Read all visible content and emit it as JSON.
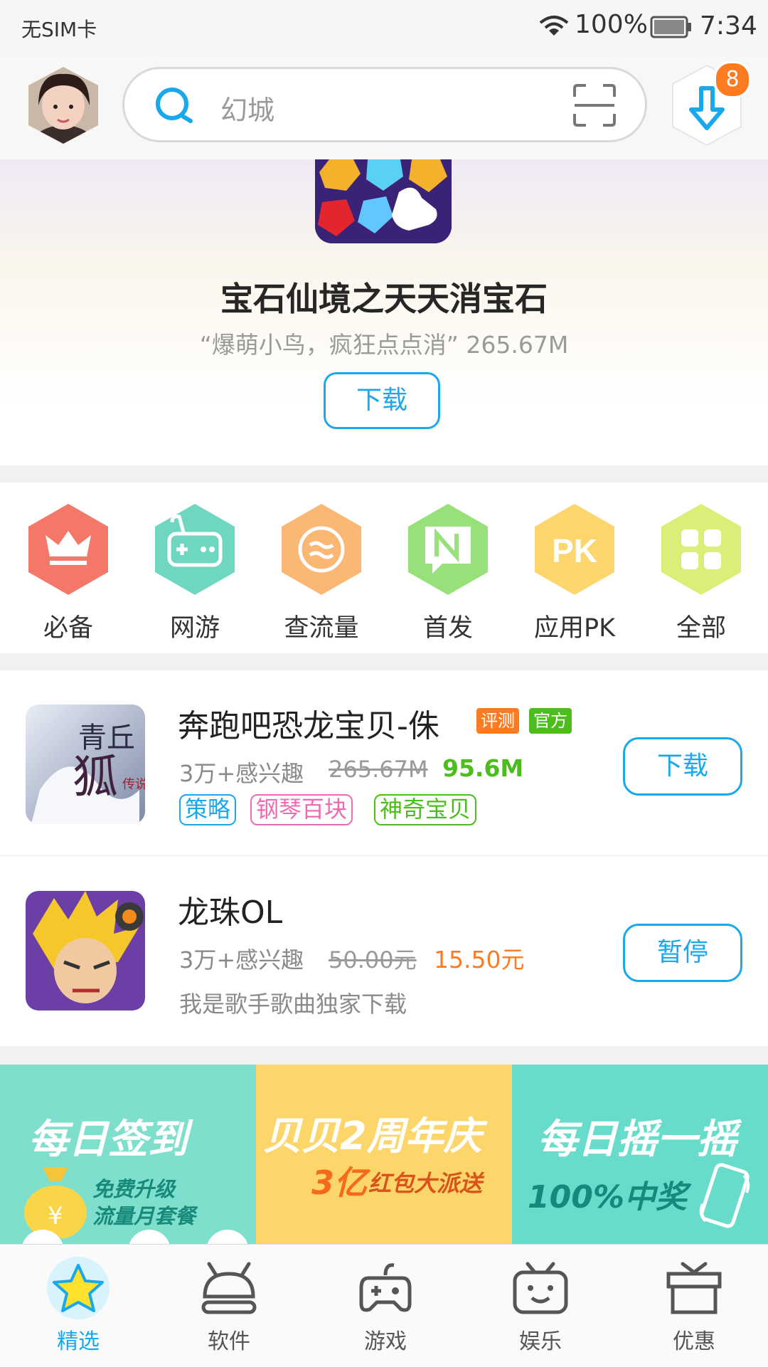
{
  "status_bar": {
    "carrier": "无SIM卡",
    "battery": "100%",
    "time": "7:34"
  },
  "search": {
    "placeholder": "幻城"
  },
  "download_badge": "8",
  "featured": {
    "title": "宝石仙境之天天消宝石",
    "subtitle": "“爆萌小鸟，疯狂点点消” 265.67M",
    "button": "下载"
  },
  "categories": [
    {
      "label": "必备",
      "icon": "crown-icon",
      "color": "#f4786a"
    },
    {
      "label": "网游",
      "icon": "gamepad-icon",
      "color": "#6fd6c1"
    },
    {
      "label": "查流量",
      "icon": "traffic-icon",
      "color": "#fbb774"
    },
    {
      "label": "首发",
      "icon": "new-flag-icon",
      "color": "#97e07a"
    },
    {
      "label": "应用PK",
      "icon": "pk-icon",
      "color": "#fdd66d"
    },
    {
      "label": "全部",
      "icon": "grid-icon",
      "color": "#d9ef78"
    }
  ],
  "apps": [
    {
      "title": "奔跑吧恐龙宝贝-侏",
      "badge_review": "评测",
      "badge_official": "官方",
      "interest": "3万+感兴趣",
      "old_size": "265.67M",
      "new_size": "95.6M",
      "tags": [
        "策略",
        "钢琴百块",
        "神奇宝贝"
      ],
      "button": "下载",
      "icon_text": [
        "青丘",
        "狐",
        "传说"
      ]
    },
    {
      "title": "龙珠OL",
      "interest": "3万+感兴趣",
      "old_price": "50.00元",
      "new_price": "15.50元",
      "desc": "我是歌手歌曲独家下载",
      "button": "暂停"
    }
  ],
  "promos": [
    {
      "title": "每日签到",
      "line1": "免费升级",
      "line2": "流量月套餐",
      "color": "#7ddfcc"
    },
    {
      "title": "贝贝2周年庆",
      "line1": "3亿",
      "line2": "红包大派送",
      "color": "#fdd66b"
    },
    {
      "title": "每日摇一摇",
      "line1": "100%中奖",
      "color": "#68dccb"
    }
  ],
  "nav": [
    {
      "label": "精选",
      "icon": "star-icon",
      "active": true
    },
    {
      "label": "软件",
      "icon": "android-icon"
    },
    {
      "label": "游戏",
      "icon": "gamepad-icon"
    },
    {
      "label": "娱乐",
      "icon": "tv-face-icon"
    },
    {
      "label": "优惠",
      "icon": "gift-icon"
    }
  ],
  "colors": {
    "accent": "#1aa8ec",
    "green": "#4cbd1c",
    "orange": "#ff7b22"
  }
}
